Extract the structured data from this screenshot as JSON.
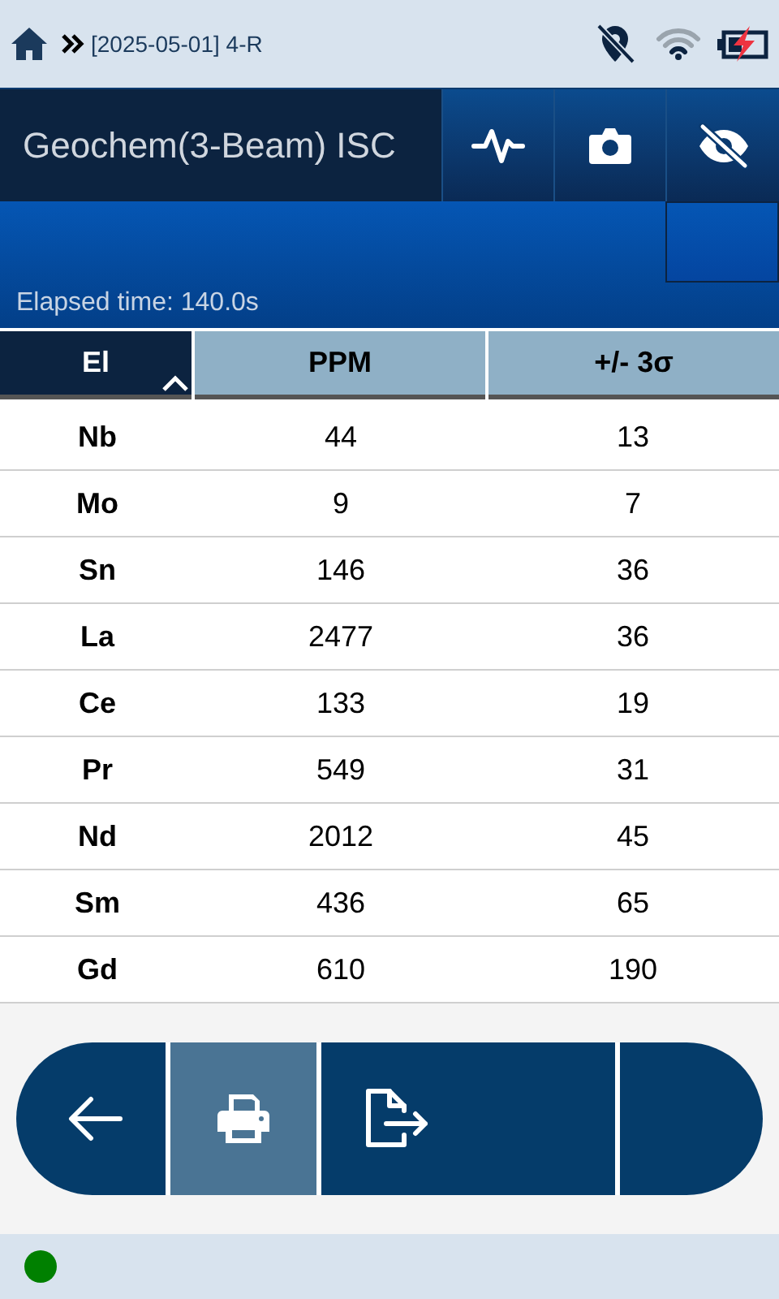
{
  "status_bar": {
    "breadcrumb": "[2025-05-01] 4-R"
  },
  "header": {
    "title": "Geochem(3-Beam) ISC"
  },
  "elapsed": "Elapsed time: 140.0s",
  "table": {
    "columns": [
      {
        "label": "El",
        "sorted": true
      },
      {
        "label": "PPM",
        "sorted": false
      },
      {
        "label": "+/- 3σ",
        "sorted": false
      }
    ],
    "rows": [
      [
        "Nb",
        "44",
        "13"
      ],
      [
        "Mo",
        "9",
        "7"
      ],
      [
        "Sn",
        "146",
        "36"
      ],
      [
        "La",
        "2477",
        "36"
      ],
      [
        "Ce",
        "133",
        "19"
      ],
      [
        "Pr",
        "549",
        "31"
      ],
      [
        "Nd",
        "2012",
        "45"
      ],
      [
        "Sm",
        "436",
        "65"
      ],
      [
        "Gd",
        "610",
        "190"
      ]
    ]
  },
  "toolbar": [
    {
      "kind": "back",
      "selected": false
    },
    {
      "kind": "print",
      "selected": true
    },
    {
      "kind": "export",
      "selected": false
    },
    {
      "kind": "empty",
      "selected": false
    }
  ],
  "footer": {
    "connected": true
  }
}
